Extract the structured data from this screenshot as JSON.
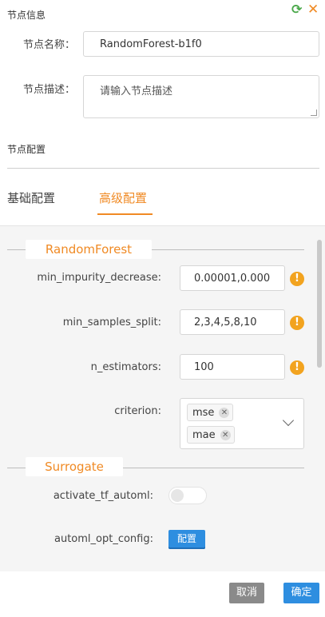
{
  "header": {
    "section_title": "节点信息",
    "refresh_icon": "refresh-icon",
    "close_icon": "close-icon",
    "refresh_color": "#4aa84a",
    "close_color": "#f08a24"
  },
  "node": {
    "name_label": "节点名称：",
    "name_value": "RandomForest-b1f0",
    "desc_label": "节点描述：",
    "desc_placeholder": "请输入节点描述"
  },
  "config": {
    "section_title": "节点配置",
    "tabs": [
      {
        "label": "基础配置",
        "active": false
      },
      {
        "label": "高级配置",
        "active": true
      }
    ]
  },
  "groups": {
    "random_forest": {
      "title": "RandomForest",
      "params": {
        "min_impurity_decrease": {
          "label": "min_impurity_decrease:",
          "value": "0.00001,0.000"
        },
        "min_samples_split": {
          "label": "min_samples_split:",
          "value": "2,3,4,5,8,10"
        },
        "n_estimators": {
          "label": "n_estimators:",
          "value": "100"
        },
        "criterion": {
          "label": "criterion:",
          "tags": [
            "mse",
            "mae"
          ]
        }
      }
    },
    "surrogate": {
      "title": "Surrogate",
      "params": {
        "activate_tf_automl": {
          "label": "activate_tf_automl:",
          "on": false
        },
        "automl_opt_config": {
          "label": "automl_opt_config:",
          "button": "配置"
        }
      }
    }
  },
  "footer": {
    "cancel": "取消",
    "ok": "确定"
  },
  "colors": {
    "accent": "#f08a24",
    "primary": "#2e8ee0",
    "warning": "#f2a31f"
  }
}
